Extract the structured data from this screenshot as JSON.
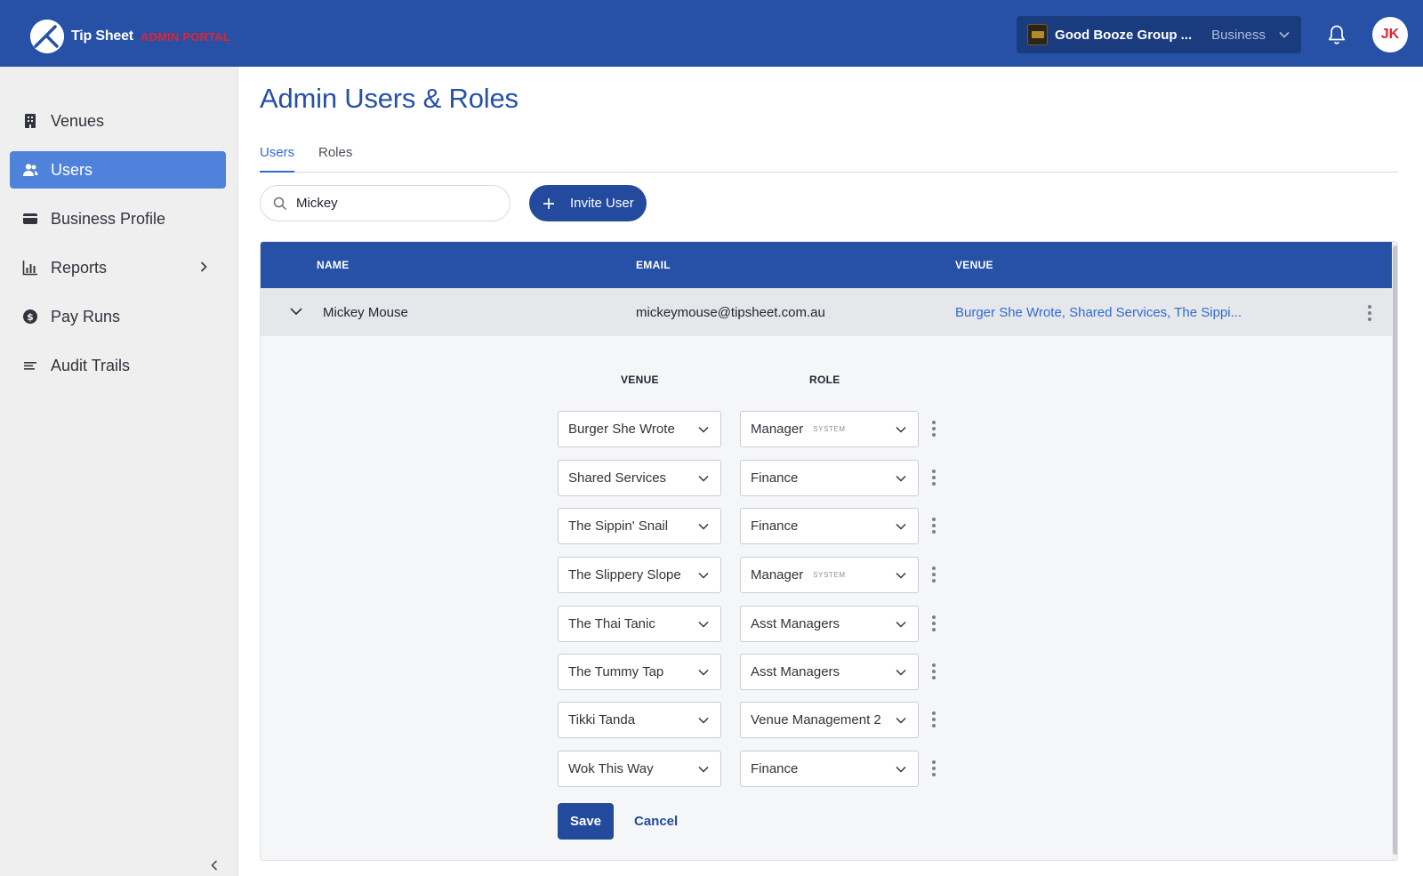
{
  "brand": {
    "name": "Tip Sheet",
    "portal_label": "ADMIN PORTAL"
  },
  "header": {
    "business_name": "Good Booze Group ...",
    "business_type": "Business",
    "user_initials": "JK"
  },
  "sidebar": {
    "items": [
      {
        "label": "Venues",
        "icon": "building-icon",
        "active": false
      },
      {
        "label": "Users",
        "icon": "users-icon",
        "active": true
      },
      {
        "label": "Business Profile",
        "icon": "card-icon",
        "active": false
      },
      {
        "label": "Reports",
        "icon": "bar-chart-icon",
        "active": false,
        "has_submenu": true
      },
      {
        "label": "Pay Runs",
        "icon": "dollar-coin-icon",
        "active": false
      },
      {
        "label": "Audit Trails",
        "icon": "list-icon",
        "active": false
      }
    ]
  },
  "page": {
    "title": "Admin Users & Roles",
    "tabs": [
      {
        "label": "Users",
        "active": true
      },
      {
        "label": "Roles",
        "active": false
      }
    ],
    "search_value": "Mickey",
    "invite_label": "Invite User"
  },
  "table": {
    "columns": [
      "NAME",
      "EMAIL",
      "VENUE"
    ],
    "rows": [
      {
        "name": "Mickey Mouse",
        "email": "mickeymouse@tipsheet.com.au",
        "venues": "Burger She Wrote, Shared Services, The Sippi..."
      }
    ]
  },
  "assignments": {
    "venue_header": "VENUE",
    "role_header": "ROLE",
    "system_tag": "SYSTEM",
    "rows": [
      {
        "venue": "Burger She Wrote",
        "role": "Manager",
        "system": true
      },
      {
        "venue": "Shared Services",
        "role": "Finance",
        "system": false
      },
      {
        "venue": "The Sippin' Snail",
        "role": "Finance",
        "system": false
      },
      {
        "venue": "The Slippery Slope",
        "role": "Manager",
        "system": true
      },
      {
        "venue": "The Thai Tanic",
        "role": "Asst Managers",
        "system": false
      },
      {
        "venue": "The Tummy Tap",
        "role": "Asst Managers",
        "system": false
      },
      {
        "venue": "Tikki Tanda",
        "role": "Venue Management 2",
        "system": false
      },
      {
        "venue": "Wok This Way",
        "role": "Finance",
        "system": false
      }
    ],
    "save_label": "Save",
    "cancel_label": "Cancel"
  },
  "colors": {
    "primary": "#2651a6",
    "button": "#234a9c",
    "active_nav": "#4f82db",
    "link": "#2f6bd1",
    "portal_red": "#e2232f"
  }
}
